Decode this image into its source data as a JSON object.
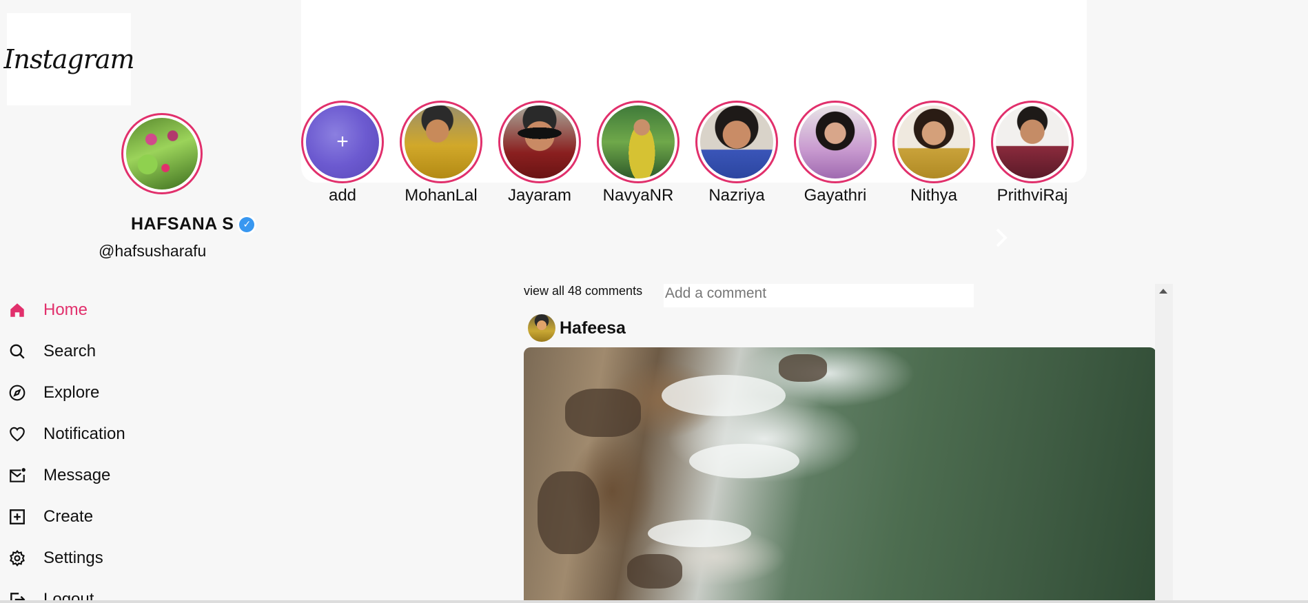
{
  "brand": {
    "logo_text": "Instagram",
    "accent_color": "#e1306c"
  },
  "profile": {
    "name": "HAFSANA S",
    "handle": "@hafsusharafu",
    "verified_icon": "verified-check-icon"
  },
  "nav": {
    "items": [
      {
        "label": "Home",
        "icon": "home-icon",
        "active": true
      },
      {
        "label": "Search",
        "icon": "search-icon"
      },
      {
        "label": "Explore",
        "icon": "compass-icon"
      },
      {
        "label": "Notification",
        "icon": "heart-icon"
      },
      {
        "label": "Message",
        "icon": "mail-icon"
      },
      {
        "label": "Create",
        "icon": "plus-square-icon"
      },
      {
        "label": "Settings",
        "icon": "gear-icon"
      },
      {
        "label": "Logout",
        "icon": "logout-icon"
      }
    ]
  },
  "stories": {
    "items": [
      {
        "label": "add"
      },
      {
        "label": "MohanLal"
      },
      {
        "label": "Jayaram"
      },
      {
        "label": "NavyaNR"
      },
      {
        "label": "Nazriya"
      },
      {
        "label": "Gayathri"
      },
      {
        "label": "Nithya"
      },
      {
        "label": "PrithviRaj"
      }
    ],
    "add_glyph": "+",
    "next_icon": "chevron-right-icon"
  },
  "feed": {
    "view_all_comments": "view all 48 comments",
    "comment_placeholder": "Add a comment",
    "post": {
      "username": "Hafeesa"
    }
  }
}
